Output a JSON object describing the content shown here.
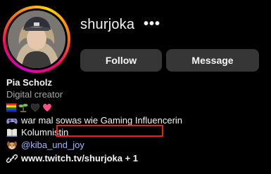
{
  "profile": {
    "username": "shurjoka",
    "more_label": "•••",
    "display_name": "Pia Scholz",
    "category": "Digital creator"
  },
  "actions": {
    "follow_label": "Follow",
    "message_label": "Message"
  },
  "bio": {
    "emoji_row": [
      "rainbow-flag-icon",
      "seedling-icon",
      "black-heart-icon",
      "pink-heart-icon"
    ],
    "line1": "war mal sowas wie Gaming Influencerin",
    "line2": "Kolumnistin",
    "line3": "@kiba_und_joy",
    "link": "www.twitch.tv/shurjoka + 1"
  },
  "colors": {
    "link": "#a4b8ff",
    "button_bg": "#363636",
    "redaction_box": "#e8201a"
  }
}
